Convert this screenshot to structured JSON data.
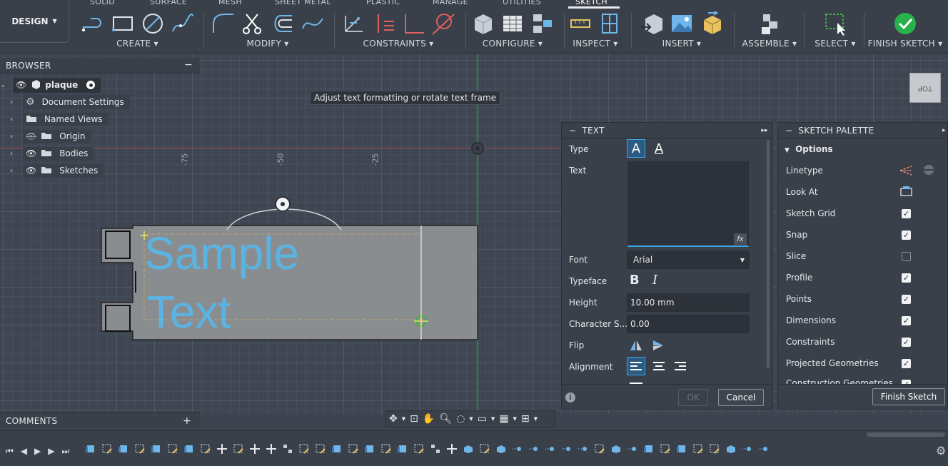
{
  "toolbar": {
    "workspace": "DESIGN",
    "tabs": [
      "SOLID",
      "SURFACE",
      "MESH",
      "SHEET METAL",
      "PLASTIC",
      "MANAGE",
      "UTILITIES",
      "SKETCH"
    ],
    "active_tab": "SKETCH",
    "groups": {
      "create": "CREATE ▾",
      "modify": "MODIFY ▾",
      "constraints": "CONSTRAINTS ▾",
      "configure": "CONFIGURE ▾",
      "inspect": "INSPECT ▾",
      "insert": "INSERT ▾",
      "assemble": "ASSEMBLE ▾",
      "select": "SELECT ▾",
      "finish": "FINISH SKETCH ▾"
    }
  },
  "browser": {
    "title": "BROWSER",
    "minimize": "−",
    "root": "plaque",
    "items": [
      "Document Settings",
      "Named Views",
      "Origin",
      "Bodies",
      "Sketches"
    ]
  },
  "tooltip": "Adjust text formatting or rotate text frame",
  "ruler": [
    "-75",
    "-50",
    "-25"
  ],
  "sketch": {
    "text": "Sample\nText",
    "line1": "Sample",
    "line2": "Text"
  },
  "text_dialog": {
    "title": "TEXT",
    "type_label": "Type",
    "text_label": "Text",
    "text_value": "",
    "fx": "fx",
    "font_label": "Font",
    "font_value": "Arial",
    "typeface_label": "Typeface",
    "height_label": "Height",
    "height_value": "10.00 mm",
    "charspacing_label": "Character S...",
    "charspacing_value": "0.00",
    "flip_label": "Flip",
    "alignment_label": "Alignment",
    "ok": "OK",
    "cancel": "Cancel"
  },
  "palette": {
    "title": "SKETCH PALETTE",
    "section": "Options",
    "finish_button": "Finish Sketch",
    "rows": [
      {
        "label": "Linetype",
        "checked": null
      },
      {
        "label": "Look At",
        "checked": null
      },
      {
        "label": "Sketch Grid",
        "checked": true
      },
      {
        "label": "Snap",
        "checked": true
      },
      {
        "label": "Slice",
        "checked": false
      },
      {
        "label": "Profile",
        "checked": true
      },
      {
        "label": "Points",
        "checked": true
      },
      {
        "label": "Dimensions",
        "checked": true
      },
      {
        "label": "Constraints",
        "checked": true
      },
      {
        "label": "Projected Geometries",
        "checked": true
      },
      {
        "label": "Construction Geometries",
        "checked": true
      }
    ]
  },
  "comments": {
    "title": "COMMENTS",
    "add": "+"
  },
  "viewcube": {
    "label": "TOP"
  },
  "colors": {
    "accent": "#3aa7e8",
    "text_fill": "#5ab4e3",
    "axis_red": "#a24a55",
    "axis_green": "#3fae4c",
    "finish_green": "#27b24a"
  }
}
